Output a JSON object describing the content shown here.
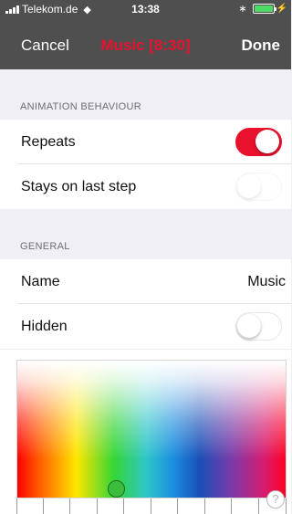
{
  "status_bar": {
    "carrier": "Telekom.de",
    "time": "13:38",
    "battery_color": "#4cd964"
  },
  "nav": {
    "cancel": "Cancel",
    "title": "Music [8:30]",
    "done": "Done",
    "title_color": "#e8122d"
  },
  "animation_section": {
    "header": "ANIMATION BEHAVIOUR",
    "repeats_label": "Repeats",
    "repeats_on": true,
    "stays_label": "Stays on last step",
    "stays_on": false
  },
  "general_section": {
    "header": "GENERAL",
    "name_label": "Name",
    "name_value": "Music",
    "hidden_label": "Hidden",
    "hidden_on": false
  },
  "color_picker": {
    "selected_hue_fraction": 0.37,
    "help_symbol": "?"
  },
  "icons": [
    "signal-icon",
    "wifi-icon",
    "bluetooth-icon",
    "battery-icon",
    "help-icon"
  ],
  "accent_color": "#e8122d"
}
